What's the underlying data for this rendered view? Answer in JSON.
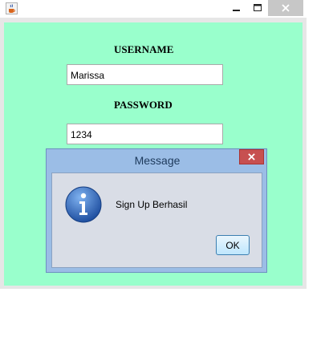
{
  "window": {
    "icons": {
      "app": "java-cup-icon",
      "minimize": "minimize-icon",
      "maximize": "maximize-icon",
      "close": "close-icon"
    }
  },
  "form": {
    "username_label": "USERNAME",
    "username_value": "Marissa",
    "password_label": "PASSWORD",
    "password_value": "1234"
  },
  "dialog": {
    "title": "Message",
    "message": "Sign Up Berhasil",
    "ok_label": "OK",
    "icon": "info-icon"
  },
  "colors": {
    "panel_bg": "#99ffcc",
    "dialog_frame": "#9bbde6",
    "dialog_close": "#c75050"
  }
}
